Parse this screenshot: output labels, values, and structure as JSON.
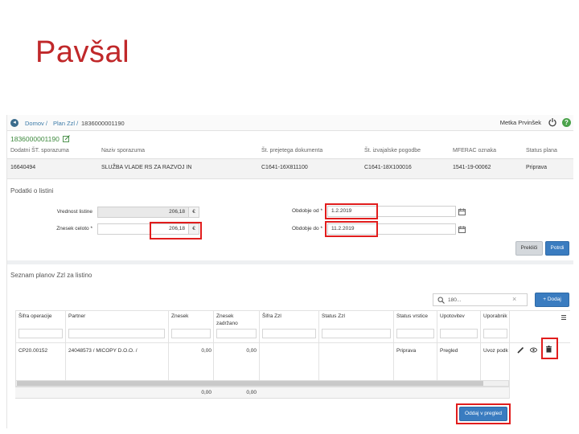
{
  "slide": {
    "title": "Pavšal"
  },
  "breadcrumb": {
    "home": "Domov /",
    "plan": "Plan Zzl /",
    "current": "1836000001190"
  },
  "user": {
    "name": "Metka Prvinšek"
  },
  "document": {
    "id": "1836000001190",
    "columns": [
      "Dodatni ŠT. sporazuma",
      "Naziv sporazuma",
      "Št. prejetega dokumenta",
      "Št. izvajalske pogodbe",
      "MFERAC oznaka",
      "Status plana"
    ],
    "values": [
      "16640494",
      "SLUŽBA VLADE RS ZA RAZVOJ IN",
      "C1641-16X811100",
      "C1641-18X100016",
      "1541-19-00062",
      "Priprava"
    ]
  },
  "form": {
    "section_title": "Podatki o listini",
    "value_label": "Vrednost listine",
    "value": "206,18",
    "amount_label": "Znesek celoto *",
    "amount": "206,18",
    "currency": "€",
    "period_from_label": "Obdobje od *",
    "period_from": "1.2.2019",
    "period_to_label": "Obdobje do *",
    "period_to": "11.2.2019",
    "cancel": "Prekliči",
    "save": "Potrdi"
  },
  "list": {
    "title": "Seznam planov Zzl za listino",
    "search_value": "180...",
    "add_button": "Dodaj",
    "columns": [
      "Šifra operacije",
      "Partner",
      "Znesek",
      "Znesek zadržano",
      "Šifra Zzl",
      "Status Zzl",
      "Status vrstice",
      "Upotovitev",
      "Uporabnik"
    ],
    "rows": [
      [
        "CP20.00152",
        "24048573 / MICOPY D.O.O. /",
        "0,00",
        "0,00",
        "",
        "",
        "Priprava",
        "Pregled",
        "Uvoz podk"
      ]
    ],
    "totals": {
      "amount": "0,00",
      "retained": "0,00"
    },
    "submit": "Oddaj v pregled"
  }
}
